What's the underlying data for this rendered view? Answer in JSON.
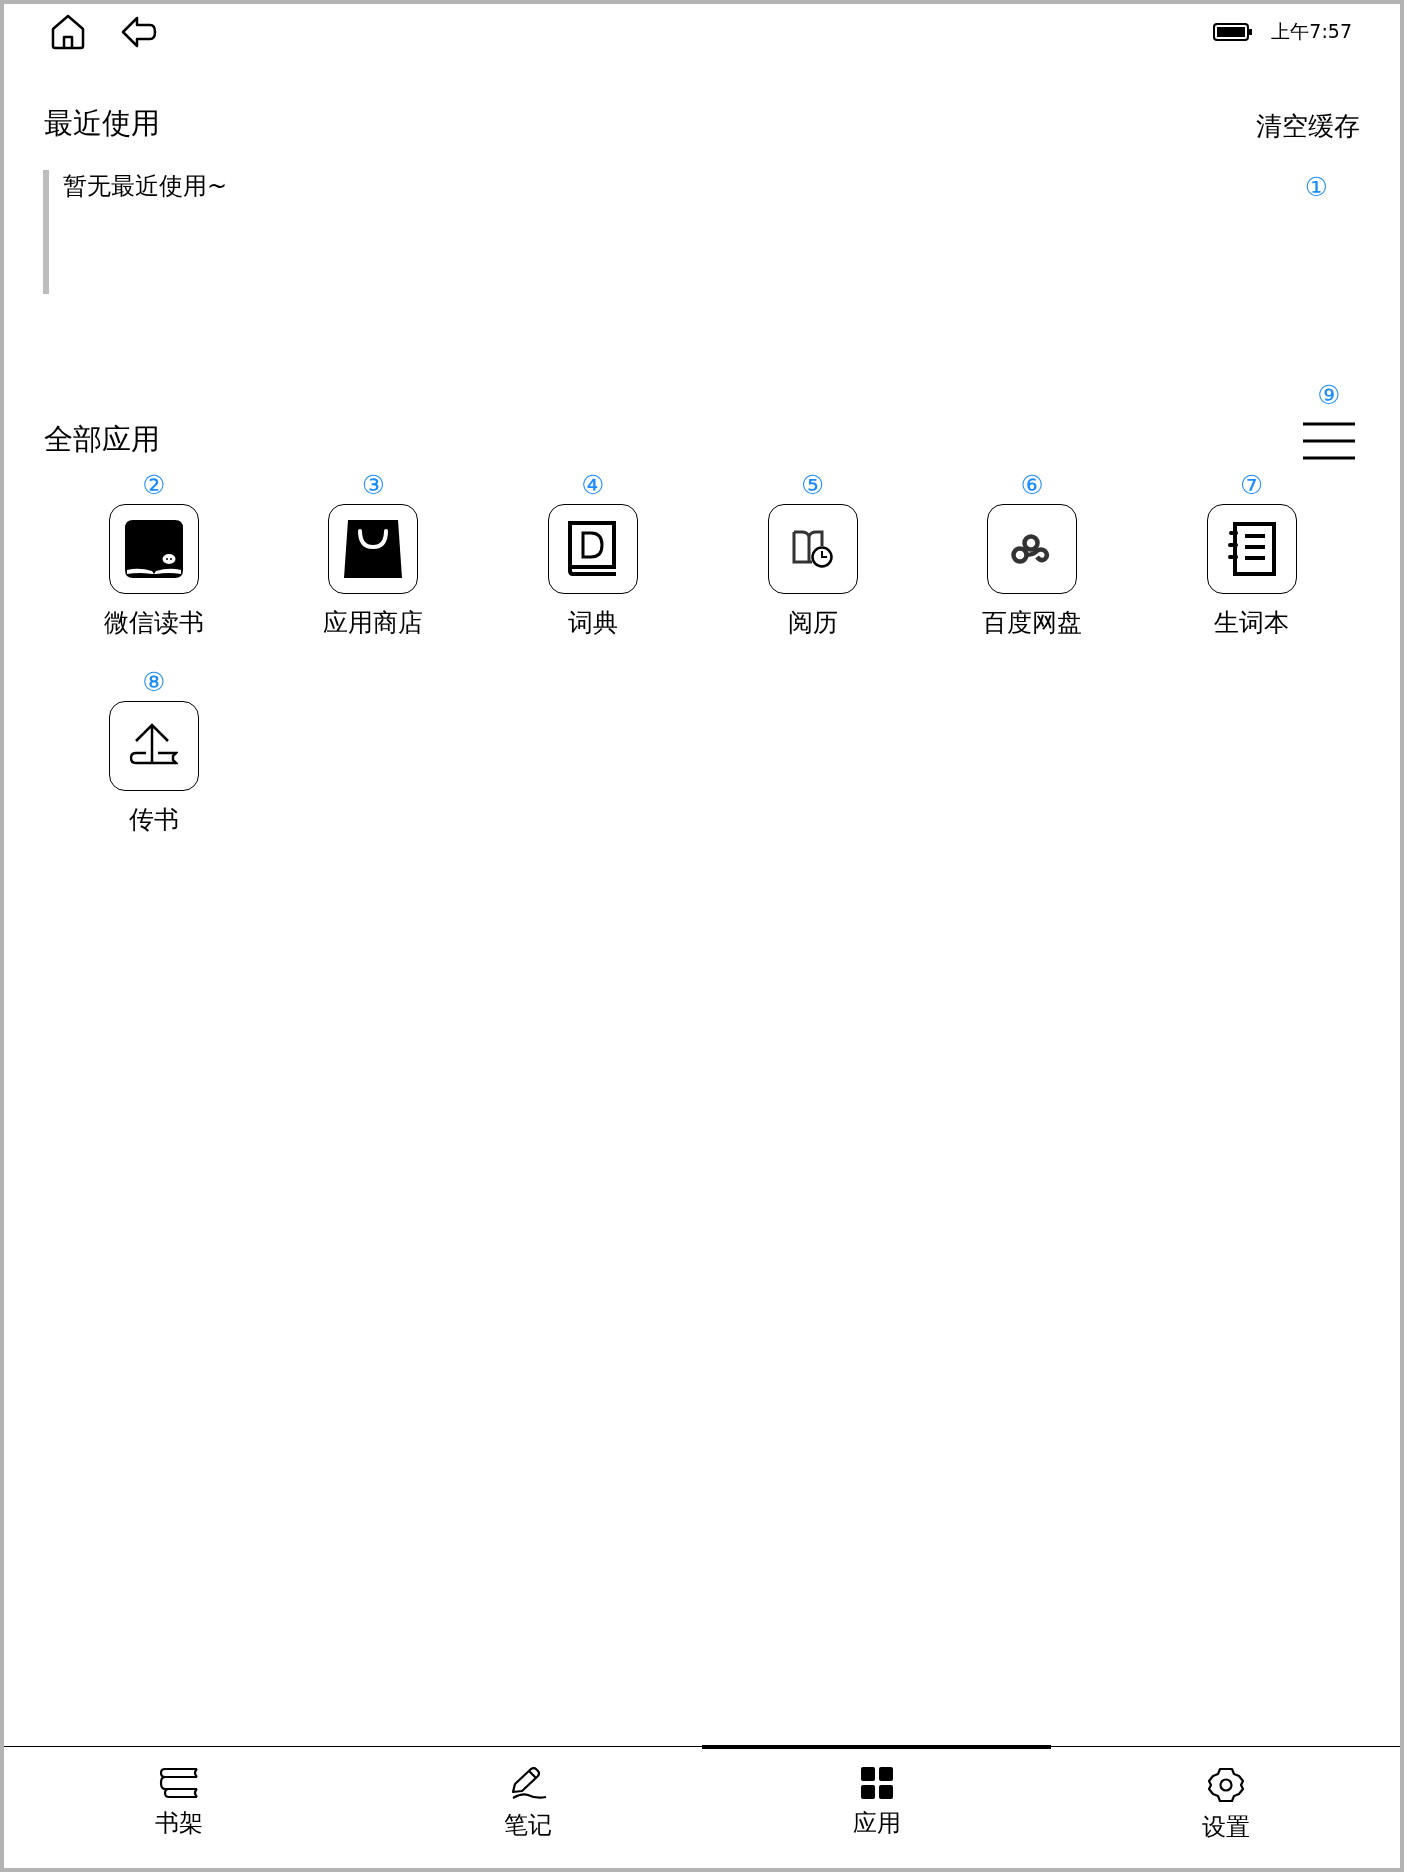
{
  "status_bar": {
    "time": "上午7:57"
  },
  "recent": {
    "title": "最近使用",
    "clear_button": "清空缓存",
    "empty_message": "暂无最近使用~",
    "marker": "①"
  },
  "all_apps": {
    "title": "全部应用",
    "menu_marker": "⑨",
    "apps": [
      {
        "name": "微信读书",
        "marker": "②",
        "kind": "reader"
      },
      {
        "name": "应用商店",
        "marker": "③",
        "kind": "store"
      },
      {
        "name": "词典",
        "marker": "④",
        "kind": "dictionary"
      },
      {
        "name": "阅历",
        "marker": "⑤",
        "kind": "history"
      },
      {
        "name": "百度网盘",
        "marker": "⑥",
        "kind": "cloud"
      },
      {
        "name": "生词本",
        "marker": "⑦",
        "kind": "notebook"
      },
      {
        "name": "传书",
        "marker": "⑧",
        "kind": "upload"
      }
    ]
  },
  "tabs": [
    {
      "label": "书架",
      "kind": "shelf",
      "selected": false
    },
    {
      "label": "笔记",
      "kind": "notes",
      "selected": false
    },
    {
      "label": "应用",
      "kind": "apps",
      "selected": true
    },
    {
      "label": "设置",
      "kind": "settings",
      "selected": false
    }
  ]
}
